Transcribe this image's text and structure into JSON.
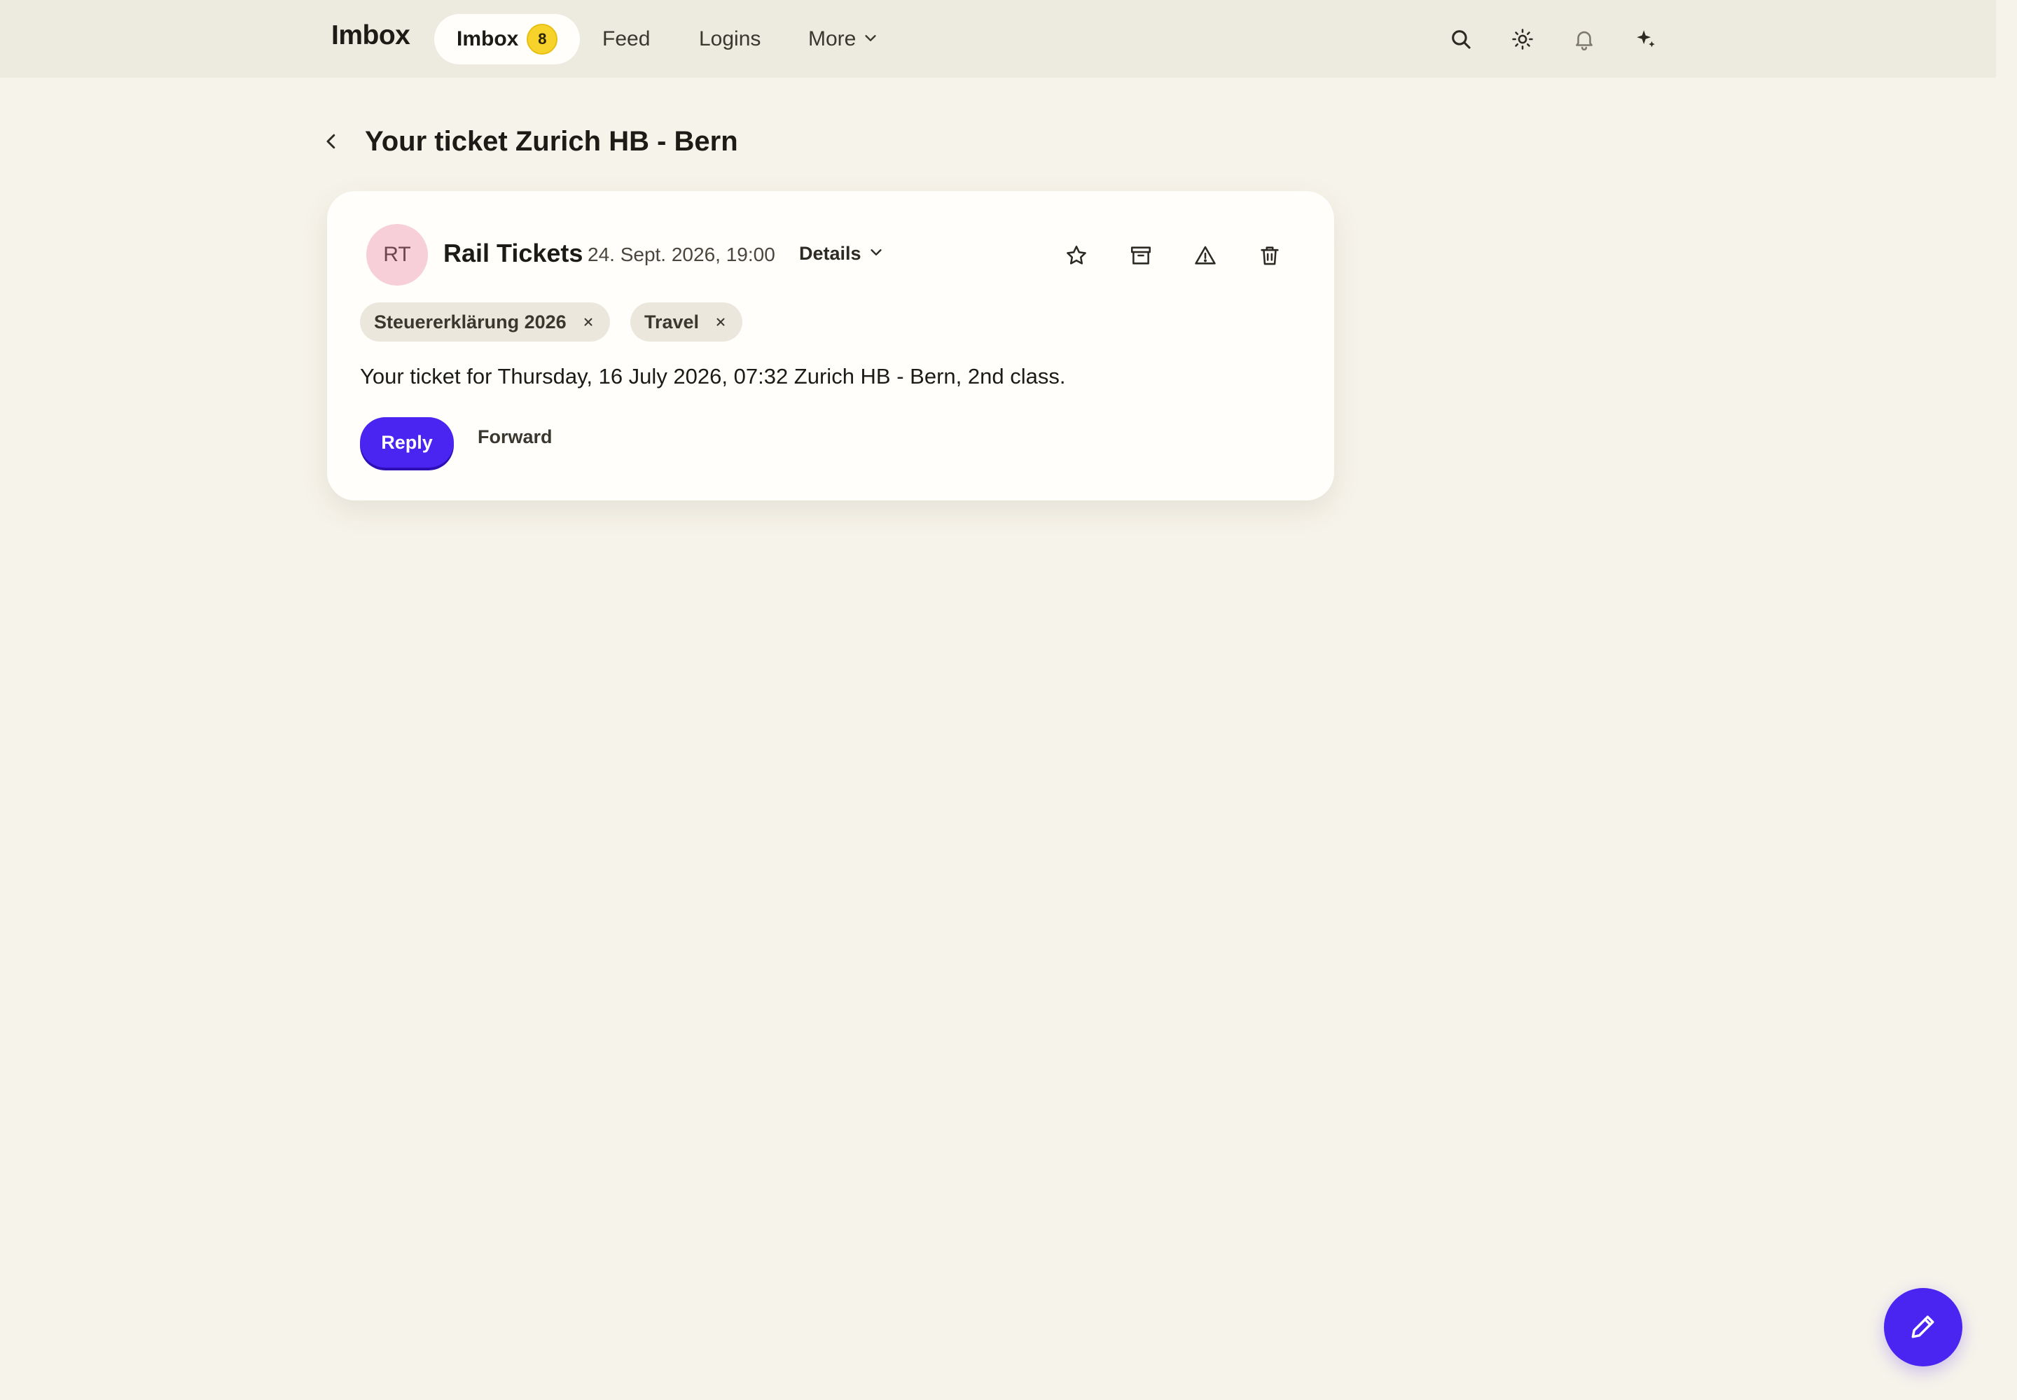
{
  "topbar": {
    "brand": "Imbox",
    "nav": [
      {
        "label": "Imbox",
        "badge": "8",
        "active": true
      },
      {
        "label": "Feed"
      },
      {
        "label": "Logins"
      },
      {
        "label": "More"
      }
    ],
    "icons": [
      "search-icon",
      "theme-sun-icon",
      "bell-icon",
      "sparkle-icon"
    ]
  },
  "page": {
    "title": "Your ticket Zurich HB - Bern"
  },
  "message": {
    "avatar_initials": "RT",
    "sender": "Rail Tickets",
    "date": "24. Sept. 2026, 19:00",
    "details_label": "Details",
    "tags": [
      "Steuererklärung 2026",
      "Travel"
    ],
    "body": "Your ticket for Thursday, 16 July 2026, 07:32 Zurich HB - Bern, 2nd class.",
    "reply_label": "Reply",
    "forward_label": "Forward",
    "actions": [
      "star-icon",
      "archive-icon",
      "report-spam-icon",
      "trash-icon"
    ]
  },
  "colors": {
    "accent": "#4a24f0",
    "badge": "#f7d22a",
    "background": "#f6f3ea",
    "topbar": "#edeae0",
    "avatar": "#f6cfd8"
  }
}
